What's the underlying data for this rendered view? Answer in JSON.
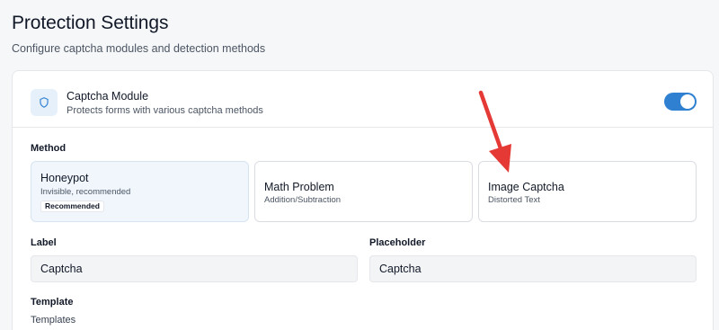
{
  "header": {
    "title": "Protection Settings",
    "subtitle": "Configure captcha modules and detection methods"
  },
  "module": {
    "icon": "shield-icon",
    "title": "Captcha Module",
    "description": "Protects forms with various captcha methods",
    "enabled": true
  },
  "method": {
    "label": "Method",
    "options": [
      {
        "title": "Honeypot",
        "description": "Invisible, recommended",
        "badge": "Recommended",
        "selected": true
      },
      {
        "title": "Math Problem",
        "description": "Addition/Subtraction",
        "selected": false
      },
      {
        "title": "Image Captcha",
        "description": "Distorted Text",
        "selected": false
      }
    ]
  },
  "fields": {
    "label": {
      "label": "Label",
      "value": "Captcha"
    },
    "placeholder": {
      "label": "Placeholder",
      "value": "Captcha"
    }
  },
  "template": {
    "label": "Template",
    "sublabel": "Templates"
  },
  "colors": {
    "accent": "#2f80d1",
    "arrow": "#e53935",
    "selected_bg": "#f0f6fc"
  }
}
